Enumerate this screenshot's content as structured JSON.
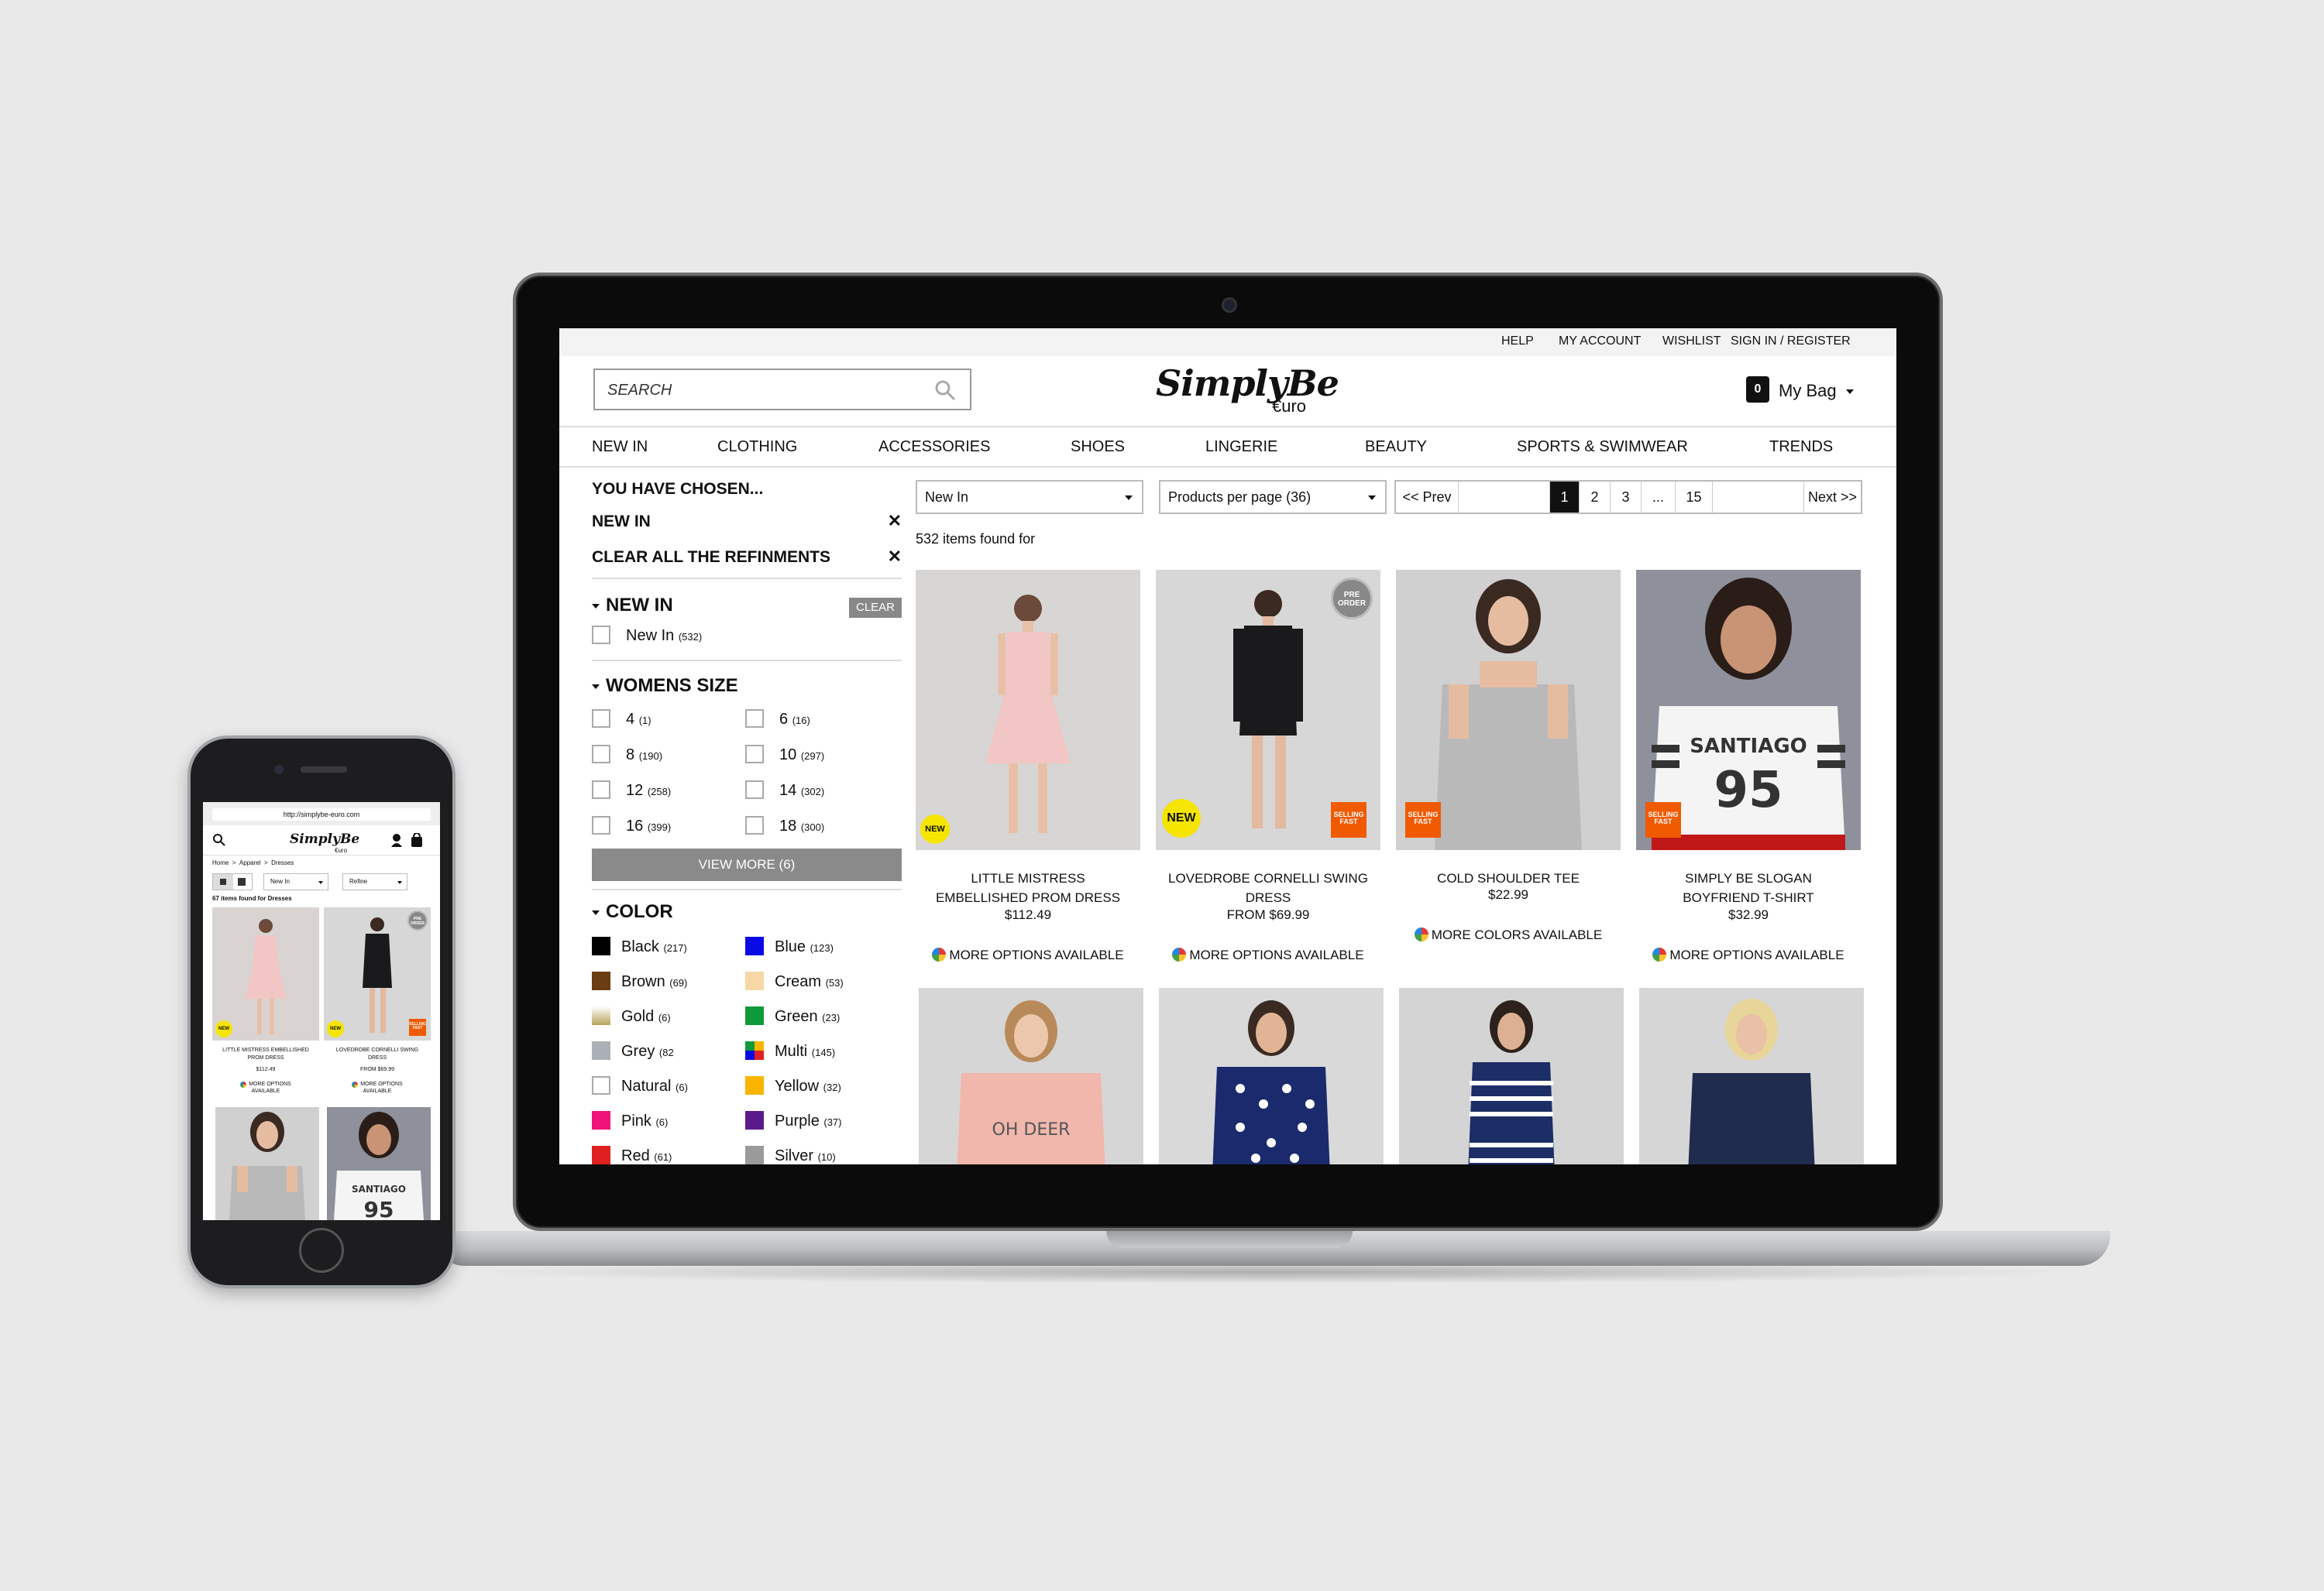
{
  "utility_links": [
    "HELP",
    "MY ACCOUNT",
    "WISHLIST",
    "SIGN IN / REGISTER"
  ],
  "search": {
    "placeholder": "SEARCH"
  },
  "brand": {
    "logo": "SimplyBe",
    "sub": "€uro"
  },
  "bag": {
    "count": "0",
    "label": "My Bag"
  },
  "nav": [
    "NEW IN",
    "CLOTHING",
    "ACCESSORIES",
    "SHOES",
    "LINGERIE",
    "BEAUTY",
    "SPORTS & SWIMWEAR",
    "TRENDS"
  ],
  "sidebar": {
    "chosen_title": "YOU HAVE CHOSEN...",
    "chosen_item": "NEW IN",
    "clear_all": "CLEAR ALL THE REFINMENTS",
    "new_in": {
      "title": "NEW IN",
      "clear": "CLEAR",
      "options": [
        {
          "label": "New In",
          "count": "(532)"
        }
      ]
    },
    "sizes": {
      "title": "WOMENS SIZE",
      "options": [
        {
          "label": "4",
          "count": "(1)"
        },
        {
          "label": "6",
          "count": "(16)"
        },
        {
          "label": "8",
          "count": "(190)"
        },
        {
          "label": "10",
          "count": "(297)"
        },
        {
          "label": "12",
          "count": "(258)"
        },
        {
          "label": "14",
          "count": "(302)"
        },
        {
          "label": "16",
          "count": "(399)"
        },
        {
          "label": "18",
          "count": "(300)"
        }
      ],
      "view_more": "VIEW MORE (6)"
    },
    "colors": {
      "title": "COLOR",
      "options": [
        {
          "label": "Black",
          "count": "(217)",
          "hex": "#000000"
        },
        {
          "label": "Blue",
          "count": "(123)",
          "hex": "#0a0ae6"
        },
        {
          "label": "Brown",
          "count": "(69)",
          "hex": "#6b3d12"
        },
        {
          "label": "Cream",
          "count": "(53)",
          "hex": "#f7d7a6"
        },
        {
          "label": "Gold",
          "count": "(6)",
          "hex": "#b8a25a"
        },
        {
          "label": "Green",
          "count": "(23)",
          "hex": "#0f9a3a"
        },
        {
          "label": "Grey",
          "count": "(82",
          "hex": "#a9b0b6"
        },
        {
          "label": "Multi",
          "count": "(145)",
          "hex": "multi"
        },
        {
          "label": "Natural",
          "count": "(6)",
          "hex": "#ffffff"
        },
        {
          "label": "Yellow",
          "count": "(32)",
          "hex": "#f7b500"
        },
        {
          "label": "Pink",
          "count": "(6)",
          "hex": "#f0147a"
        },
        {
          "label": "Purple",
          "count": "(37)",
          "hex": "#5a1a8c"
        },
        {
          "label": "Red",
          "count": "(61)",
          "hex": "#e02020"
        },
        {
          "label": "Silver",
          "count": "(10)",
          "hex": "#9a9a9a"
        }
      ]
    }
  },
  "toolbar": {
    "sort": "New In",
    "per_page": "Products per page (36)",
    "prev": "<< Prev",
    "next": "Next >>",
    "pages": [
      "1",
      "2",
      "3",
      "...",
      "15"
    ],
    "found": "532 items found for"
  },
  "products": [
    {
      "name1": "LITTLE MISTRESS",
      "name2": "EMBELLISHED PROM DRESS",
      "price": "$112.49",
      "options": "MORE OPTIONS AVAILABLE",
      "badge_new": "NEW"
    },
    {
      "name1": "LOVEDROBE CORNELLI SWING",
      "name2": "DRESS",
      "price": "FROM $69.99",
      "options": "MORE OPTIONS AVAILABLE",
      "badge_new": "NEW",
      "badge_fast": "SELLING FAST",
      "badge_pre": "PRE ORDER"
    },
    {
      "name1": "COLD SHOULDER TEE",
      "name2": "",
      "price": "$22.99",
      "options": "MORE COLORS AVAILABLE",
      "badge_fast": "SELLING FAST"
    },
    {
      "name1": "SIMPLY BE SLOGAN",
      "name2": "BOYFRIEND T-SHIRT",
      "price": "$32.99",
      "options": "MORE OPTIONS AVAILABLE",
      "badge_fast": "SELLING FAST",
      "shirt_text1": "SANTIAGO",
      "shirt_text2": "95"
    }
  ],
  "row2_print": "OH DEER",
  "phone": {
    "url": "http://simplybe-euro.com",
    "logo": "SimplyBe",
    "sub": "€uro",
    "breadcrumb": [
      "Home",
      ">",
      "Apparel",
      ">",
      "Dresses"
    ],
    "sort": "New In",
    "refine": "Refine",
    "found": "67 items found for Dresses",
    "p1_name1": "LITTLE MISTRESS EMBELLISHED",
    "p1_name2": "PROM DRESS",
    "p1_price": "$112.49",
    "p2_name1": "LOVEDROBE CORNELLI SWING",
    "p2_name2": "DRESS",
    "p2_price": "FROM $69.99",
    "opts1": "MORE OPTIONS",
    "opts2": "AVAILABLE",
    "new": "NEW",
    "pre": "PRE ORDER",
    "fast": "SELLING FAST",
    "shirt": "SANTIAGO",
    "shirt_num": "95"
  }
}
